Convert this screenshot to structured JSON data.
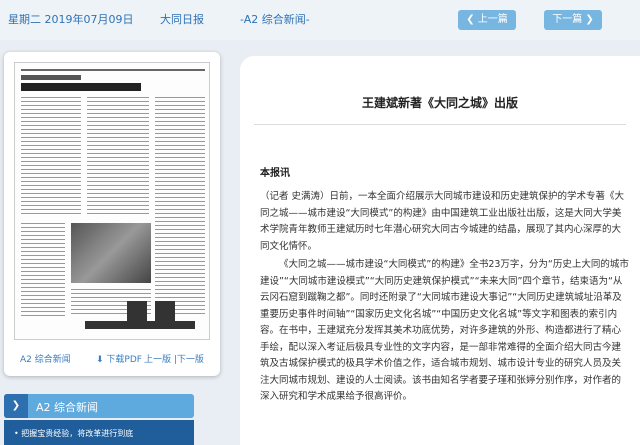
{
  "topbar": {
    "date": "星期二 2019年07月09日",
    "paper": "大同日报",
    "page": "-A2 综合新闻-",
    "prev_label": "上一篇",
    "next_label": "下一篇"
  },
  "thumbnail": {
    "page_link": "A2 综合新闻",
    "download_link": "下载PDF",
    "page_nav": "上一版 |下一版"
  },
  "sidebar": {
    "section_label": "A2  综合新闻",
    "items": [
      "把握宝贵经验，将改革进行到底"
    ]
  },
  "article": {
    "title": "王建斌新著《大同之城》出版",
    "byline": "本报讯",
    "paragraphs": [
      "（记者 史满涛）日前，一本全面介绍展示大同城市建设和历史建筑保护的学术专著《大同之城——城市建设“大同模式”的构建》由中国建筑工业出版社出版，这是大同大学美术学院青年教师王建斌历时七年潜心研究大同古今城建的结晶，展现了其内心深厚的大同文化情怀。",
      "《大同之城——城市建设“大同模式”的构建》全书23万字，分为“历史上大同的城市建设”“大同城市建设模式”“大同历史建筑保护模式”“未来大同”四个章节，结束语为“从云冈石窟到蹴鞠之都”。同时还附录了“大同城市建设大事记”“大同历史建筑城址沿革及重要历史事件时间轴”“国家历史文化名城”“中国历史文化名城”等文字和图表的索引内容。在书中，王建斌充分发挥其美术功底优势，对许多建筑的外形、构造都进行了精心手绘，配以深入考证后极具专业性的文字内容，是一部非常难得的全面介绍大同古今建筑及古城保护模式的极具学术价值之作，适合城市规划、城市设计专业的研究人员及关注大同城市规划、建设的人士阅读。该书由知名学者要子瑾和张婷分别作序，对作者的深入研究和学术成果给予很高评价。"
    ]
  }
}
